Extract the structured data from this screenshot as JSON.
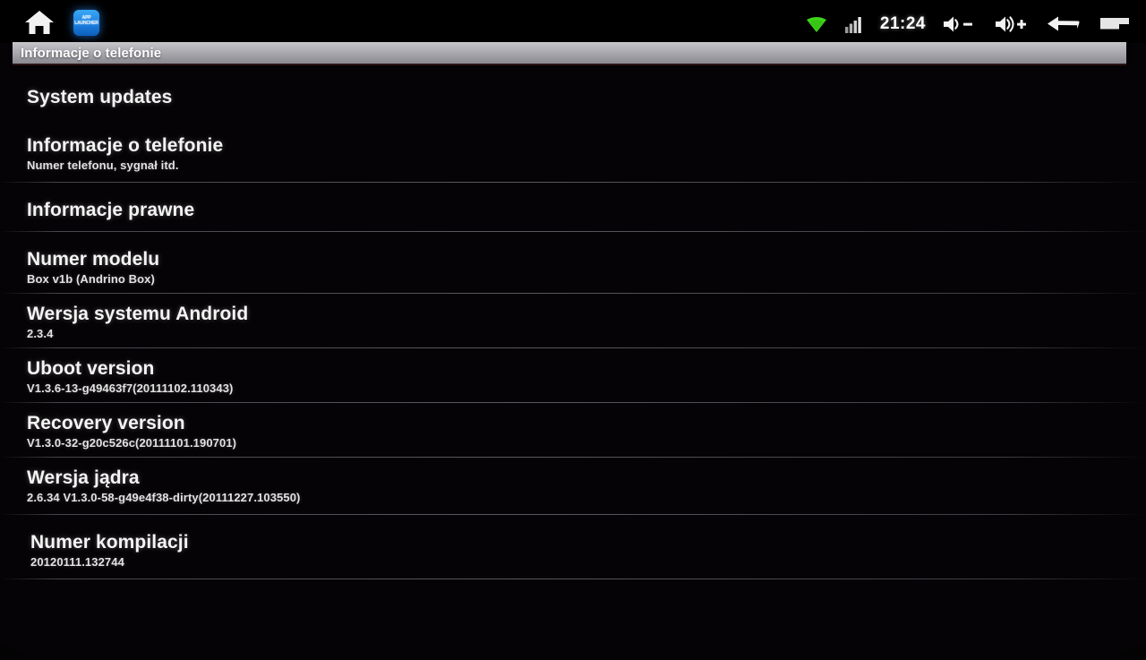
{
  "statusbar": {
    "left_icons": [
      {
        "name": "home-icon",
        "label": "Home"
      },
      {
        "name": "app-icon",
        "label": "APP\nLAUNCHER"
      }
    ],
    "wifi": {
      "name": "wifi-icon",
      "color": "#3fd41a"
    },
    "signal": {
      "name": "signal-bars-icon"
    },
    "clock": "21:24",
    "volume_down": {
      "name": "volume-down-icon",
      "label": "Volume down"
    },
    "volume_up": {
      "name": "volume-up-icon",
      "label": "Volume up"
    },
    "back": {
      "name": "back-icon",
      "label": "Back"
    },
    "menu": {
      "name": "menu-icon",
      "label": "Menu"
    }
  },
  "titlebar": {
    "title": "Informacje o telefonie"
  },
  "list": {
    "items": [
      {
        "title": "System updates",
        "subtitle": ""
      },
      {
        "title": "Informacje o telefonie",
        "subtitle": "Numer telefonu, sygnał itd."
      },
      {
        "title": "Informacje prawne",
        "subtitle": ""
      },
      {
        "title": "Numer modelu",
        "subtitle": "Box v1b (Andrino Box)"
      },
      {
        "title": "Wersja systemu Android",
        "subtitle": "2.3.4"
      },
      {
        "title": "Uboot version",
        "subtitle": "V1.3.6-13-g49463f7(20111102.110343)"
      },
      {
        "title": "Recovery version",
        "subtitle": "V1.3.0-32-g20c526c(20111101.190701)"
      },
      {
        "title": "Wersja jądra",
        "subtitle": "2.6.34  V1.3.0-58-g49e4f38-dirty(20111227.103550)"
      },
      {
        "title": "Numer kompilacji",
        "subtitle": "20120111.132744"
      }
    ]
  }
}
